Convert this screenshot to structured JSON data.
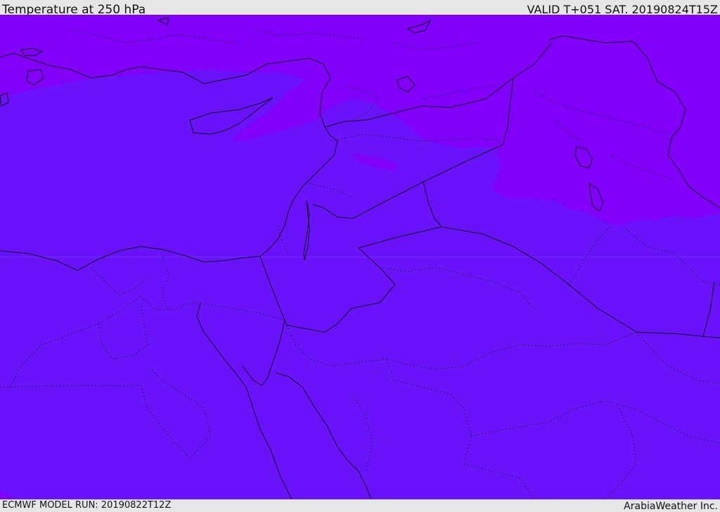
{
  "header": {
    "title": "Temperature at 250 hPa",
    "valid": "VALID T+051 SAT. 20190824T15Z"
  },
  "footer": {
    "model_run": "ECMWF MODEL RUN: 20190822T12Z",
    "credit": "ArabiaWeather Inc."
  },
  "map": {
    "fill_colors": {
      "warm_band": "#6a13fb",
      "cold_band": "#8000fa"
    },
    "line_colors": {
      "coastline": "#111111",
      "border": "#111111",
      "province": "#222244"
    }
  }
}
